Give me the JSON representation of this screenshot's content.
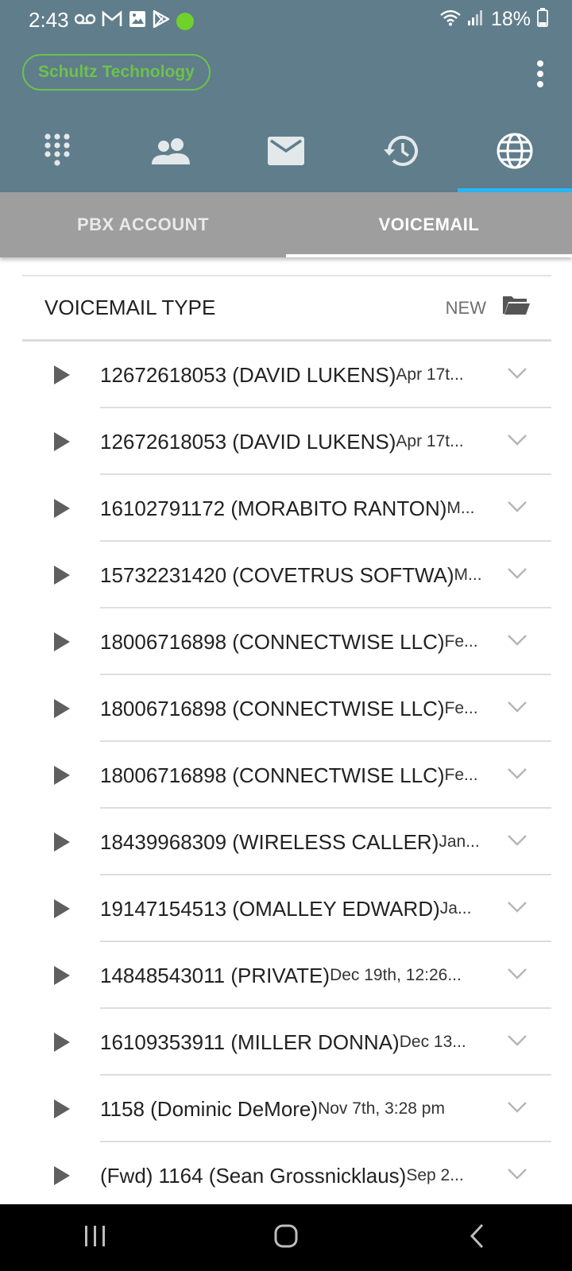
{
  "status_bar": {
    "time": "2:43",
    "battery": "18%",
    "left_icons": [
      "voicemail-icon",
      "gmail-icon",
      "gallery-icon",
      "play-store-icon",
      "green-dot"
    ],
    "right_icons": [
      "wifi-icon",
      "signal-icon",
      "battery-icon"
    ]
  },
  "header": {
    "company": "Schultz Technology",
    "accent_color": "#6cc24a",
    "header_color": "#607d8b",
    "nav_tabs": [
      {
        "name": "dialpad-tab",
        "icon": "dialpad-icon",
        "active": false
      },
      {
        "name": "contacts-tab",
        "icon": "contacts-icon",
        "active": false
      },
      {
        "name": "messages-tab",
        "icon": "mail-icon",
        "active": false
      },
      {
        "name": "history-tab",
        "icon": "history-icon",
        "active": false
      },
      {
        "name": "web-tab",
        "icon": "globe-icon",
        "active": true
      }
    ]
  },
  "sub_tabs": {
    "pbx": "PBX ACCOUNT",
    "voicemail": "VOICEMAIL",
    "active": "VOICEMAIL"
  },
  "voicemail_type": {
    "label": "VOICEMAIL TYPE",
    "value": "NEW"
  },
  "voicemails": [
    {
      "caller": "12672618053 (DAVID LUKENS)",
      "date": "Apr 17t..."
    },
    {
      "caller": "12672618053 (DAVID LUKENS)",
      "date": "Apr 17t..."
    },
    {
      "caller": "16102791172 (MORABITO RANTON)",
      "date": "M..."
    },
    {
      "caller": "15732231420 (COVETRUS SOFTWA)",
      "date": "M..."
    },
    {
      "caller": "18006716898 (CONNECTWISE LLC)",
      "date": "Fe..."
    },
    {
      "caller": "18006716898 (CONNECTWISE LLC)",
      "date": "Fe..."
    },
    {
      "caller": "18006716898 (CONNECTWISE LLC)",
      "date": "Fe..."
    },
    {
      "caller": "18439968309 (WIRELESS CALLER)",
      "date": "Jan..."
    },
    {
      "caller": "19147154513 (OMALLEY EDWARD)",
      "date": "Ja..."
    },
    {
      "caller": "14848543011 (PRIVATE)",
      "date": "Dec 19th, 12:26..."
    },
    {
      "caller": "16109353911 (MILLER DONNA)",
      "date": "Dec 13..."
    },
    {
      "caller": "1158 (Dominic DeMore)",
      "date": " Nov 7th, 3:28 pm"
    },
    {
      "caller": "(Fwd) 1164 (Sean Grossnicklaus)",
      "date": "Sep 2..."
    }
  ],
  "system_nav": [
    "recents-button",
    "home-button",
    "back-button"
  ]
}
